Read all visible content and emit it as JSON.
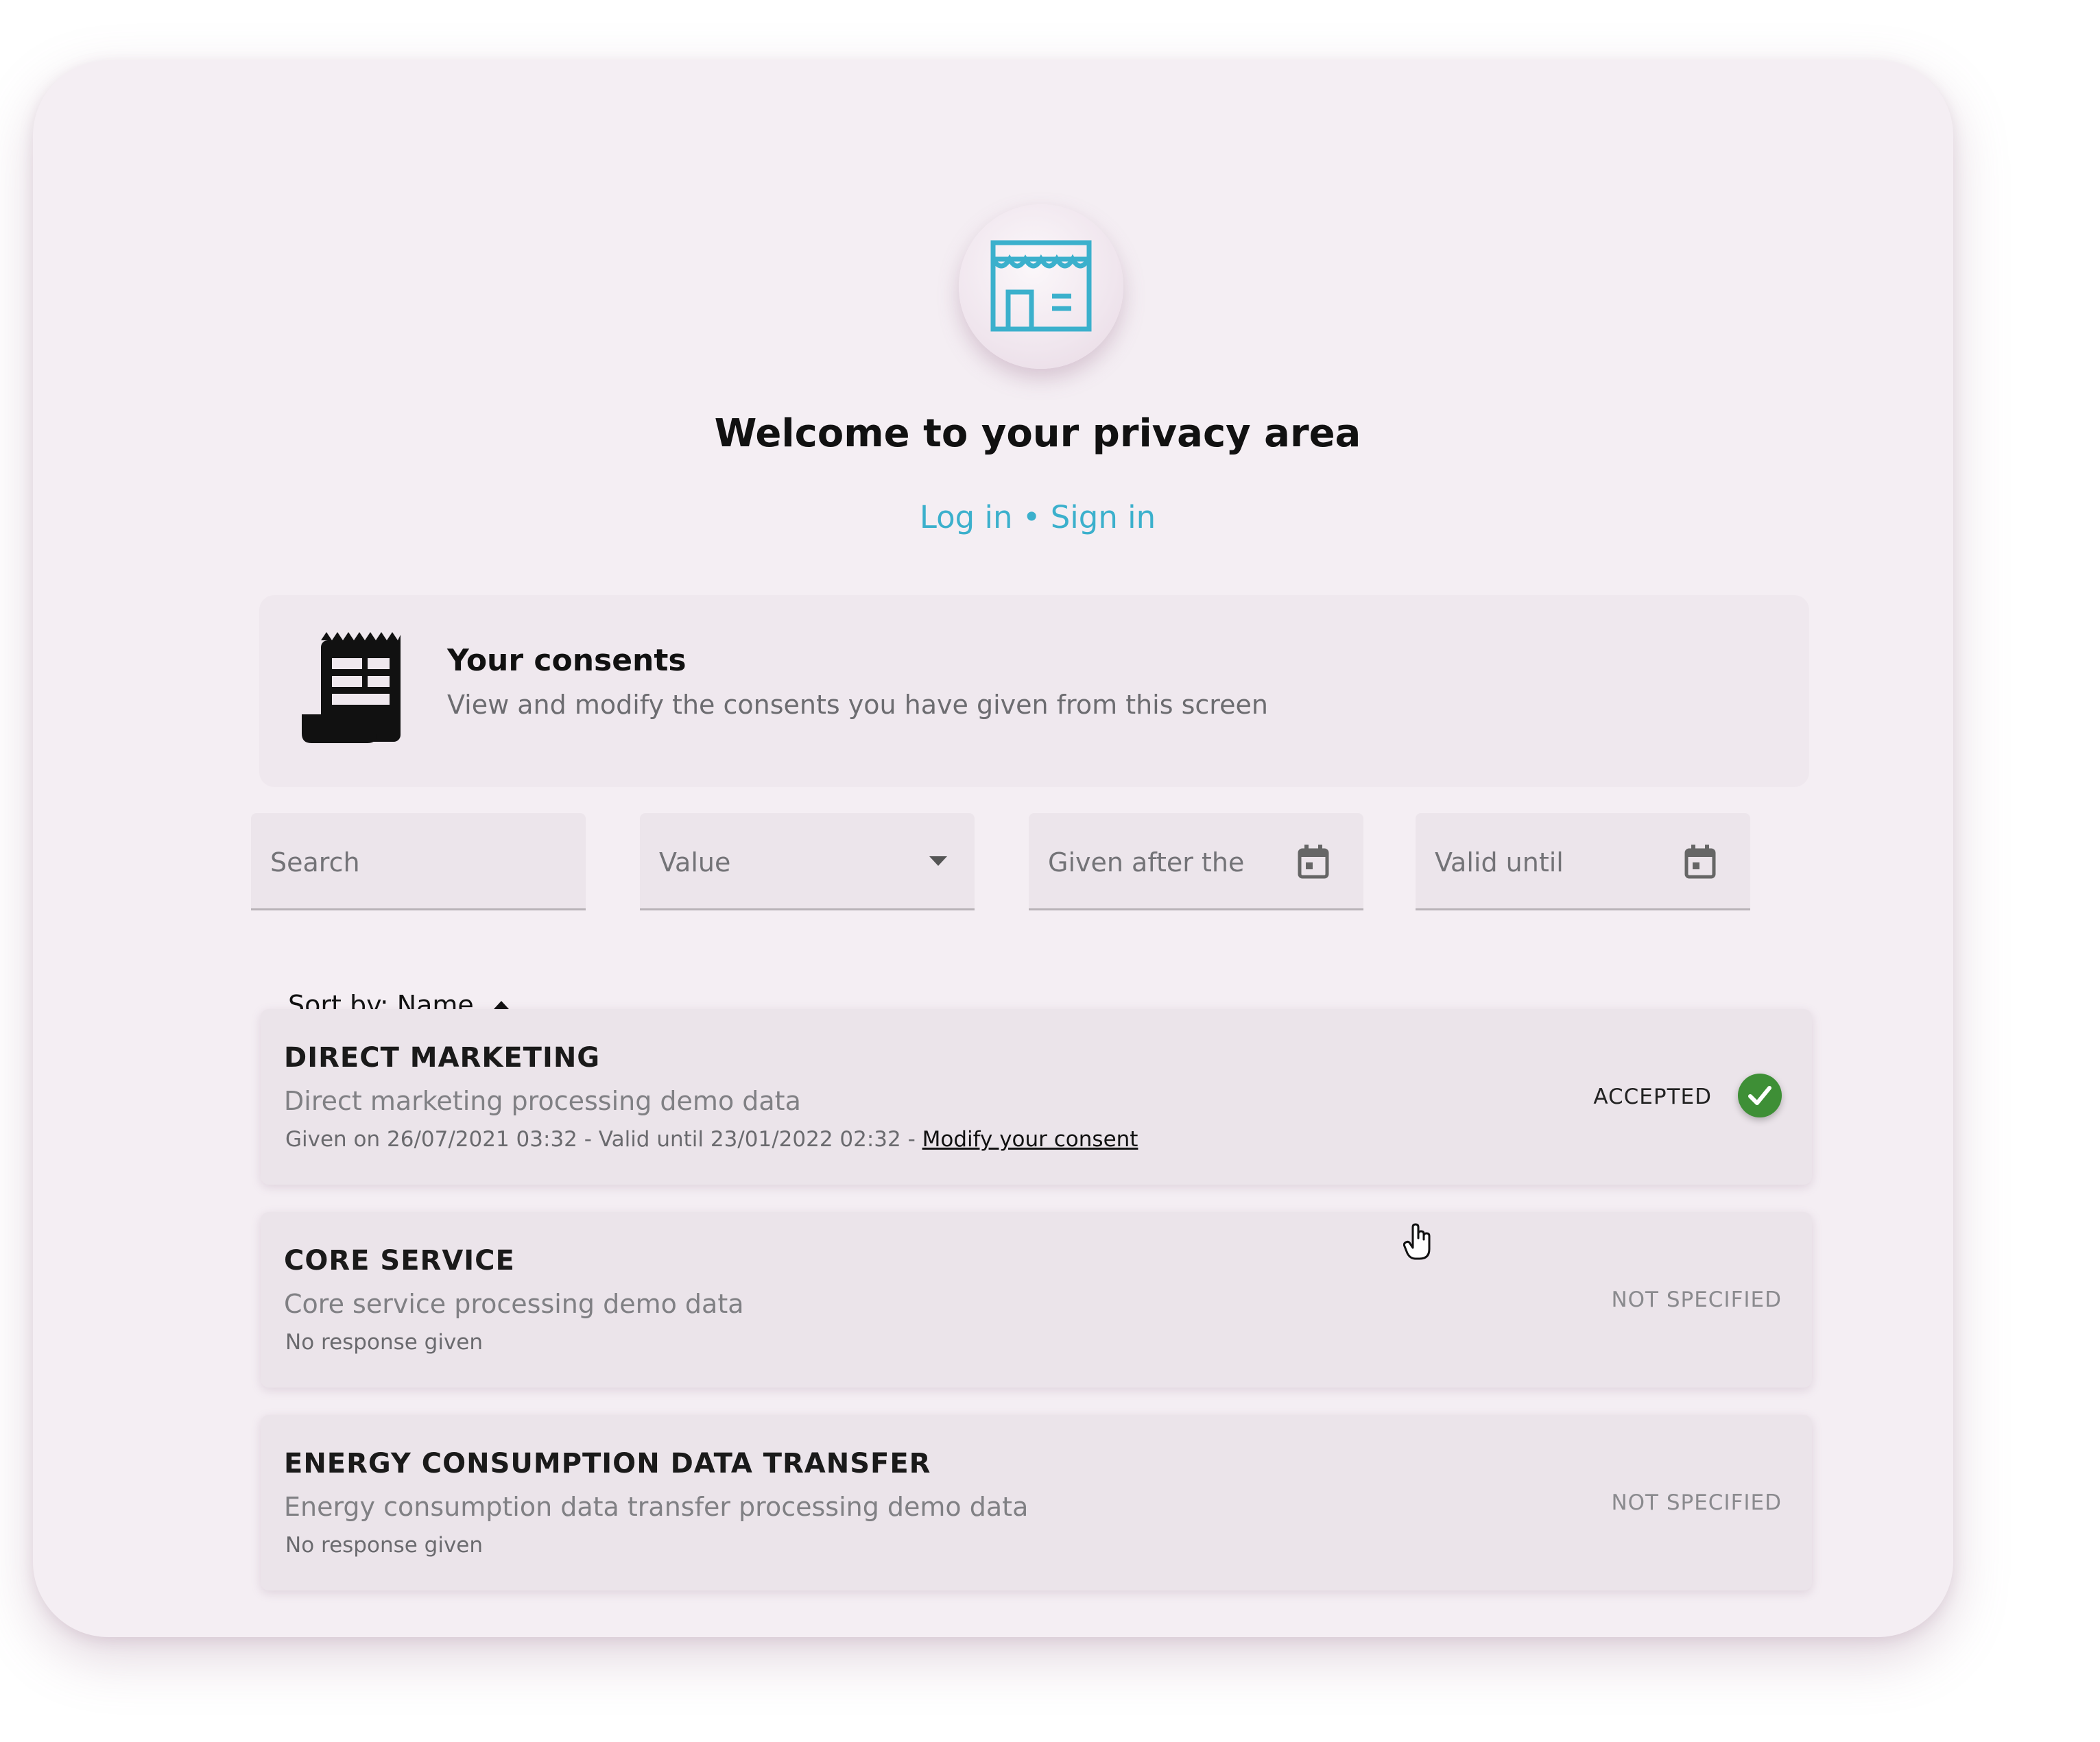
{
  "header": {
    "title": "Welcome to your privacy area",
    "login_label": "Log in",
    "separator": "•",
    "signin_label": "Sign in"
  },
  "consents_panel": {
    "title": "Your consents",
    "subtitle": "View and modify the consents you have given from this screen"
  },
  "filters": {
    "search_placeholder": "Search",
    "value_placeholder": "Value",
    "given_after_placeholder": "Given after the",
    "valid_until_placeholder": "Valid until"
  },
  "sort": {
    "label": "Sort by: Name"
  },
  "consents": [
    {
      "name": "DIRECT MARKETING",
      "description": "Direct marketing processing demo data",
      "meta": "Given on 26/07/2021 03:32 - Valid until  23/01/2022 02:32 - ",
      "modify_link": "Modify your consent",
      "status": "ACCEPTED"
    },
    {
      "name": "CORE SERVICE",
      "description": "Core service processing demo data",
      "meta": "No response given",
      "status": "NOT SPECIFIED"
    },
    {
      "name": "ENERGY CONSUMPTION DATA TRANSFER",
      "description": "Energy consumption data transfer processing demo data",
      "meta": "No response given",
      "status": "NOT SPECIFIED"
    }
  ],
  "colors": {
    "accent": "#3bb0cc",
    "accepted": "#3e8f36",
    "card_bg": "#f4eef3"
  },
  "icons": [
    "store-icon",
    "receipt-icon",
    "dropdown-arrow-icon",
    "calendar-icon",
    "sort-ascending-icon",
    "check-icon",
    "hand-cursor-icon"
  ]
}
